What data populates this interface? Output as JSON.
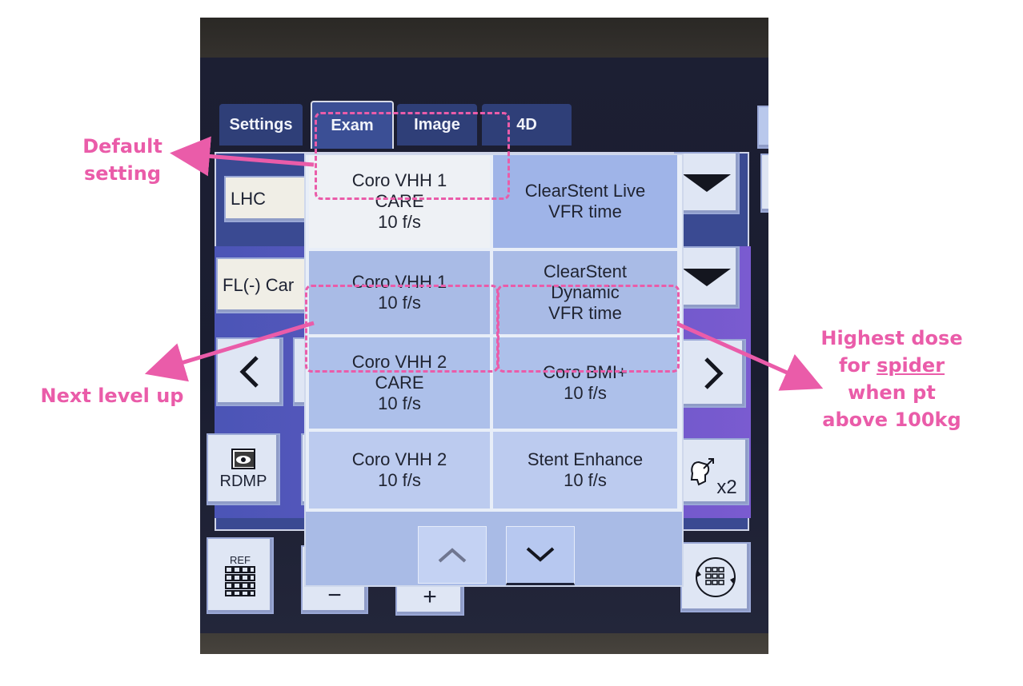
{
  "tabs": [
    "Settings",
    "Exam",
    "Image",
    "4D"
  ],
  "left_fields": {
    "top": "LHC",
    "mid": "FL(-) Car"
  },
  "side_controls": {
    "rdmp_label": "RDMP",
    "ref_label": "REF",
    "minus": "−",
    "plus": "+",
    "x2_label": "x2"
  },
  "menu": {
    "rows": [
      {
        "left": "Coro VHH 1\nCARE\n10 f/s",
        "right": "ClearStent Live\nVFR time"
      },
      {
        "left": "Coro VHH 1\n10 f/s",
        "right": "ClearStent\nDynamic\nVFR time"
      },
      {
        "left": "Coro VHH 2\nCARE\n10 f/s",
        "right": "Coro BMI+\n10 f/s"
      },
      {
        "left": "Coro VHH 2\n10 f/s",
        "right": "Stent Enhance\n10 f/s"
      }
    ]
  },
  "annotations": {
    "default": "Default\nsetting",
    "next": "Next level up",
    "highest_prefix": "Highest dose",
    "highest_for": "for",
    "highest_spider": "spider",
    "highest_rest": "when pt\nabove 100kg"
  },
  "colors": {
    "annotation": "#ea5ca9",
    "screen_blue": "#3a4a92",
    "menu_cell": "#a9bbe6",
    "menu_cell_default": "#eef1f5"
  }
}
